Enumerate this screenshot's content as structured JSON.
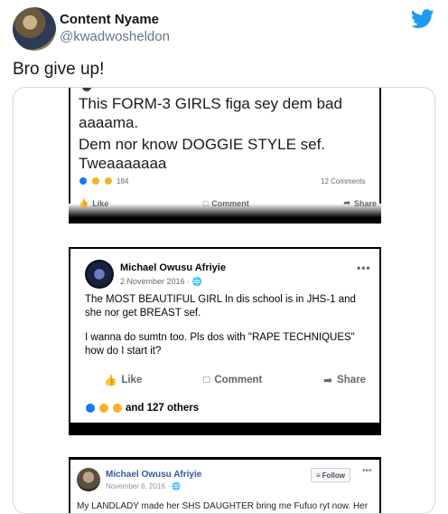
{
  "tweet": {
    "author_name": "Content Nyame",
    "author_handle": "@kwadwosheldon",
    "text": "Bro give up!",
    "brand_icon": "twitter-bird-icon",
    "brand_color": "#1d9bf0"
  },
  "screenshot_post_1": {
    "lines": [
      "This FORM-3 GIRLS figa sey dem bad",
      "aaaama.",
      "Dem nor know DOGGIE STYLE sef.",
      "Tweaaaaaaa"
    ],
    "reaction_count": "184",
    "comments": "12 Comments",
    "actions": [
      "Like",
      "Comment",
      "Share"
    ]
  },
  "screenshot_post_2": {
    "author": "Michael Owusu Afriyie",
    "date": "2 November 2016 · ",
    "paragraph_1": "The MOST BEAUTIFUL GIRL In dis school is in JHS-1 and she nor get BREAST sef.",
    "paragraph_2": "I wanna do sumtn too. Pls dos with \"RAPE TECHNIQUES\" how do I start it?",
    "actions": [
      "Like",
      "Comment",
      "Share"
    ],
    "reactions_text": "and 127 others",
    "more": "•••"
  },
  "screenshot_post_3": {
    "author": "Michael Owusu Afriyie",
    "date": "November 6, 2016 · ",
    "follow": "Follow",
    "more": "•••",
    "text": "My LANDLADY made her SHS DAUGHTER bring me Fufuo ryt now. Her"
  },
  "colors": {
    "facebook_blue": "#1877f2",
    "facebook_link": "#365899"
  }
}
